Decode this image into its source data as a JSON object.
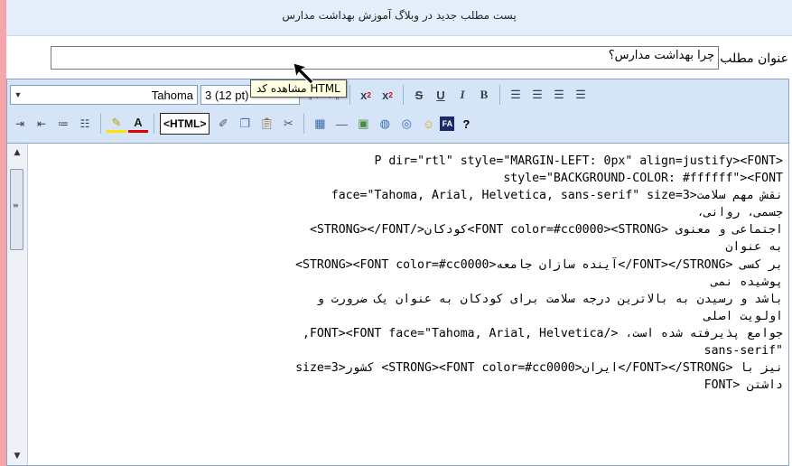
{
  "header": {
    "title": "پست مطلب جدید در وبلاگ آموزش بهداشت مدارس"
  },
  "post_title": {
    "label": "عنوان مطلب:",
    "value": "چرا بهداشت مدارس؟"
  },
  "toolbar": {
    "font_family": "Tahoma",
    "font_size": "3 (12 pt)",
    "html_button_label": "<HTML>",
    "tooltip": "HTML مشاهده کد",
    "help_label": "?",
    "fa_label": "FA"
  },
  "icons": [
    "ltr-icon",
    "rtl-icon",
    "superscript-icon",
    "subscript-icon",
    "strikethrough-icon",
    "underline-icon",
    "italic-icon",
    "bold-icon",
    "justify-full-icon",
    "align-right-icon",
    "align-center-icon",
    "align-left-icon",
    "indent-icon",
    "outdent-icon",
    "bullet-list-icon",
    "numbered-list-icon",
    "highlight-icon",
    "font-color-icon",
    "eraser-icon",
    "copy-icon",
    "paste-icon",
    "cut-icon",
    "table-icon",
    "horizontal-rule-icon",
    "image-icon",
    "link-icon",
    "unlink-icon",
    "smiley-icon"
  ],
  "code_lines": [
    "P dir=\"rtl\" style=\"MARGIN-LEFT: 0px\" align=justify><FONT>",
    "style=\"BACKGROUND-COLOR: #ffffff\"><FONT",
    "face=\"Tahoma, Arial, Helvetica, sans-serif\" size=3>نقش مهم سلامت",
    "جسمی، روانی،",
    "اجتماعی و معنوی <FONT color=#cc0000><STRONG>کودکان</STRONG></FONT>",
    "به عنوان",
    "<STRONG><FONT color=#cc0000>آینده سازان جامعه</FONT></STRONG> بر کسی",
    "پوشیده نمی",
    "باشد و رسیدن به بالاترین درجه سلامت برای کودکان به عنوان یک ضرورت و",
    "اولویت اصلی",
    "جوامع پذیرفته شده است، </FONT><FONT face=\"Tahoma, Arial, Helvetica,",
    "sans-serif\"",
    "size=3>کشور <STRONG><FONT color=#cc0000>ایران</FONT></STRONG> نیز با",
    "داشتن <FONT"
  ]
}
